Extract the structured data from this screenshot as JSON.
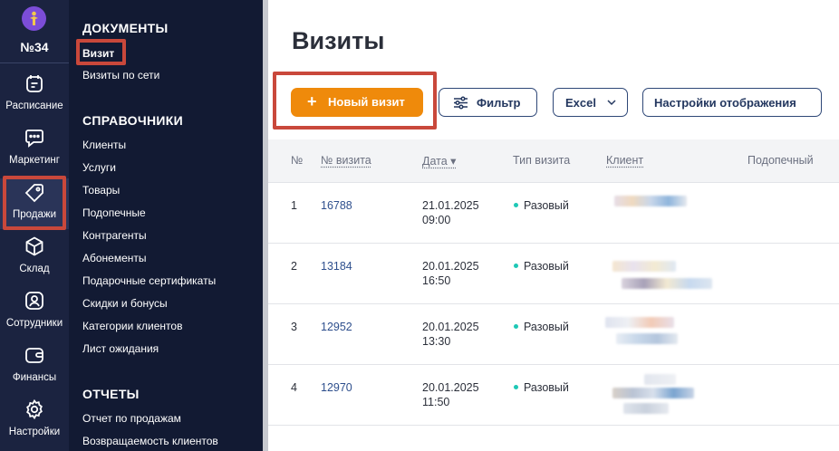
{
  "rail": {
    "branch": "№34",
    "items": [
      {
        "label": "Расписание",
        "icon": "calendar-icon"
      },
      {
        "label": "Маркетинг",
        "icon": "chat-icon"
      },
      {
        "label": "Продажи",
        "icon": "tag-icon"
      },
      {
        "label": "Склад",
        "icon": "box-icon"
      },
      {
        "label": "Сотрудники",
        "icon": "user-icon"
      },
      {
        "label": "Финансы",
        "icon": "wallet-icon"
      },
      {
        "label": "Настройки",
        "icon": "gear-icon"
      }
    ]
  },
  "menu": {
    "documents_title": "ДОКУМЕНТЫ",
    "documents": [
      "Визит",
      "Визиты по сети"
    ],
    "directories_title": "СПРАВОЧНИКИ",
    "directories": [
      "Клиенты",
      "Услуги",
      "Товары",
      "Подопечные",
      "Контрагенты",
      "Абонементы",
      "Подарочные сертификаты",
      "Скидки и бонусы",
      "Категории клиентов",
      "Лист ожидания"
    ],
    "reports_title": "ОТЧЕТЫ",
    "reports": [
      "Отчет по продажам",
      "Возвращаемость клиентов"
    ]
  },
  "main": {
    "title": "Визиты",
    "new_visit": "Новый визит",
    "filter": "Фильтр",
    "excel": "Excel",
    "display_settings": "Настройки отображения"
  },
  "table": {
    "columns": [
      "№",
      "№ визита",
      "Дата ▾",
      "Тип визита",
      "Клиент",
      "Подопечный"
    ],
    "rows": [
      {
        "n": "1",
        "visit": "16788",
        "date": "21.01.2025",
        "time": "09:00",
        "type": "Разовый"
      },
      {
        "n": "2",
        "visit": "13184",
        "date": "20.01.2025",
        "time": "16:50",
        "type": "Разовый"
      },
      {
        "n": "3",
        "visit": "12952",
        "date": "20.01.2025",
        "time": "13:30",
        "type": "Разовый"
      },
      {
        "n": "4",
        "visit": "12970",
        "date": "20.01.2025",
        "time": "11:50",
        "type": "Разовый"
      }
    ]
  },
  "colors": {
    "rail_bg": "#1b2340",
    "menu_bg": "#121a33",
    "accent": "#ef8a0b",
    "highlight": "#c9483b",
    "link": "#2e4f8d",
    "status_dot": "#1ec8b6"
  }
}
